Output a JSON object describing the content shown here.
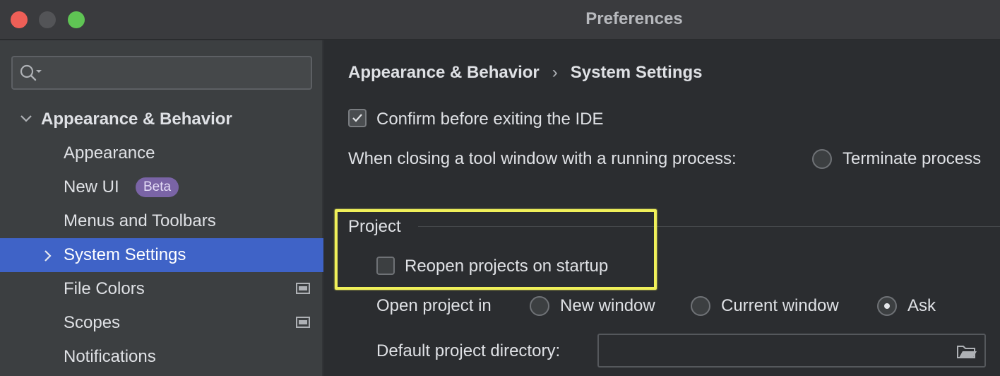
{
  "window": {
    "title": "Preferences"
  },
  "search": {
    "placeholder": ""
  },
  "sidebar": {
    "group": {
      "label": "Appearance & Behavior",
      "expanded": true
    },
    "items": [
      {
        "label": "Appearance"
      },
      {
        "label": "New UI",
        "badge": "Beta"
      },
      {
        "label": "Menus and Toolbars"
      },
      {
        "label": "System Settings",
        "selected": true
      },
      {
        "label": "File Colors"
      },
      {
        "label": "Scopes"
      },
      {
        "label": "Notifications"
      }
    ]
  },
  "breadcrumb": {
    "parent": "Appearance & Behavior",
    "separator": "›",
    "current": "System Settings"
  },
  "settings": {
    "confirm_exit": {
      "label": "Confirm before exiting the IDE",
      "checked": true
    },
    "tool_window_close": {
      "label": "When closing a tool window with a running process:",
      "option": "Terminate process",
      "selected": false
    },
    "project_section": {
      "title": "Project"
    },
    "reopen_projects": {
      "label": "Reopen projects on startup",
      "checked": false
    },
    "open_project_in": {
      "label": "Open project in",
      "options": [
        {
          "label": "New window",
          "selected": false
        },
        {
          "label": "Current window",
          "selected": false
        },
        {
          "label": "Ask",
          "selected": true
        }
      ]
    },
    "default_dir": {
      "label": "Default project directory:",
      "value": ""
    }
  },
  "colors": {
    "accent_selection": "#3f63c7",
    "highlight": "#f0f05a",
    "badge": "#7a64a6"
  }
}
